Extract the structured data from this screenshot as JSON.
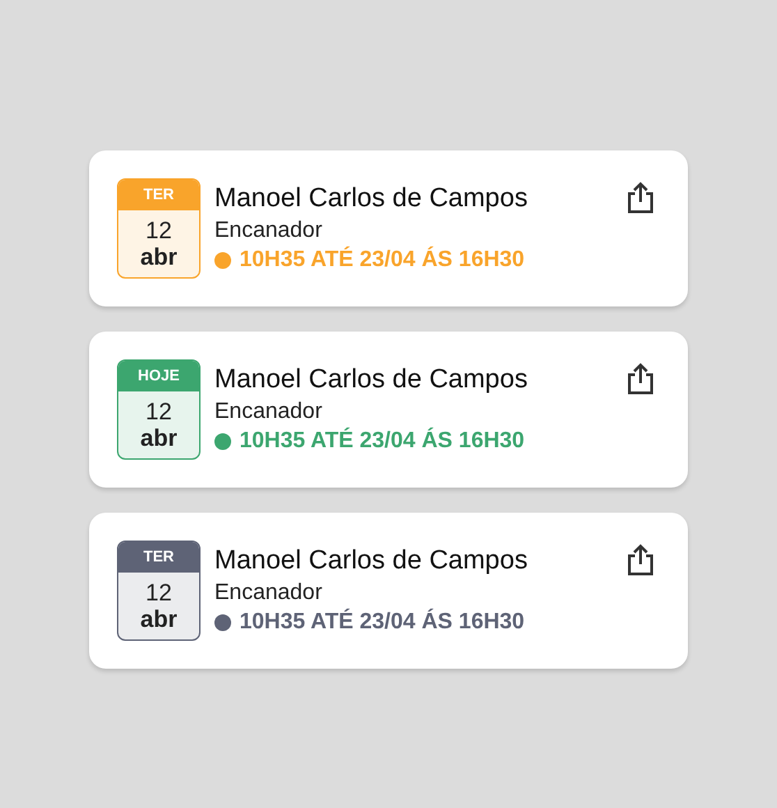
{
  "cards": [
    {
      "weekday": "TER",
      "day": "12",
      "month": "abr",
      "name": "Manoel Carlos de Campos",
      "role": "Encanador",
      "period": "10H35 ATÉ 23/04 ÁS 16H30",
      "color": "#f9a42b"
    },
    {
      "weekday": "HOJE",
      "day": "12",
      "month": "abr",
      "name": "Manoel Carlos de Campos",
      "role": "Encanador",
      "period": "10H35 ATÉ 23/04 ÁS 16H30",
      "color": "#3ca66f"
    },
    {
      "weekday": "TER",
      "day": "12",
      "month": "abr",
      "name": "Manoel Carlos de Campos",
      "role": "Encanador",
      "period": "10H35 ATÉ 23/04 ÁS 16H30",
      "color": "#5e6376"
    }
  ]
}
